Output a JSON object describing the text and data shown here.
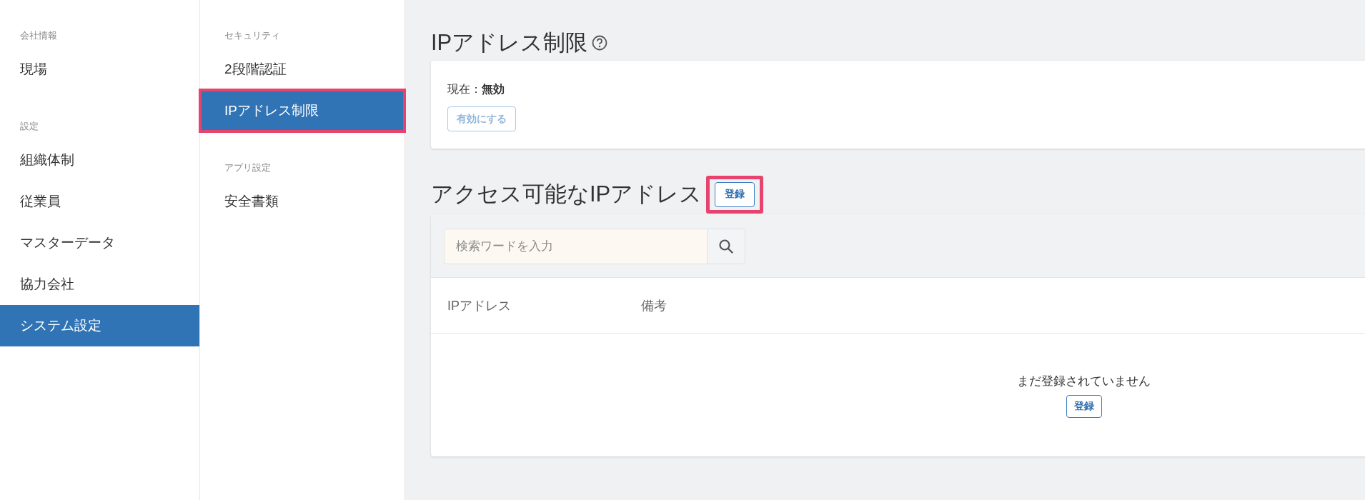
{
  "main_nav": {
    "groups": [
      {
        "heading": "会社情報",
        "items": [
          {
            "label": "現場",
            "selected": false
          }
        ]
      },
      {
        "heading": "設定",
        "items": [
          {
            "label": "組織体制",
            "selected": false
          },
          {
            "label": "従業員",
            "selected": false
          },
          {
            "label": "マスターデータ",
            "selected": false
          },
          {
            "label": "協力会社",
            "selected": false
          },
          {
            "label": "システム設定",
            "selected": true
          }
        ]
      }
    ]
  },
  "sub_nav": {
    "groups": [
      {
        "heading": "セキュリティ",
        "items": [
          {
            "label": "2段階認証",
            "selected": false,
            "highlighted": false
          },
          {
            "label": "IPアドレス制限",
            "selected": true,
            "highlighted": true
          }
        ]
      },
      {
        "heading": "アプリ設定",
        "items": [
          {
            "label": "安全書類",
            "selected": false,
            "highlighted": false
          }
        ]
      }
    ]
  },
  "restriction": {
    "title": "IPアドレス制限",
    "status": "現在：**無効**",
    "enable_button": {
      "label": "有効にする",
      "disabled": true
    }
  },
  "address_list": {
    "title": "アクセス可能なIPアドレス",
    "register_button": {
      "label": "登録",
      "highlighted": true
    },
    "search": {
      "placeholder": "検索ワードを入力"
    },
    "columns": [
      "IPアドレス",
      "備考"
    ],
    "empty_message": "まだ登録されていません",
    "empty_register_button": {
      "label": "登録"
    }
  }
}
